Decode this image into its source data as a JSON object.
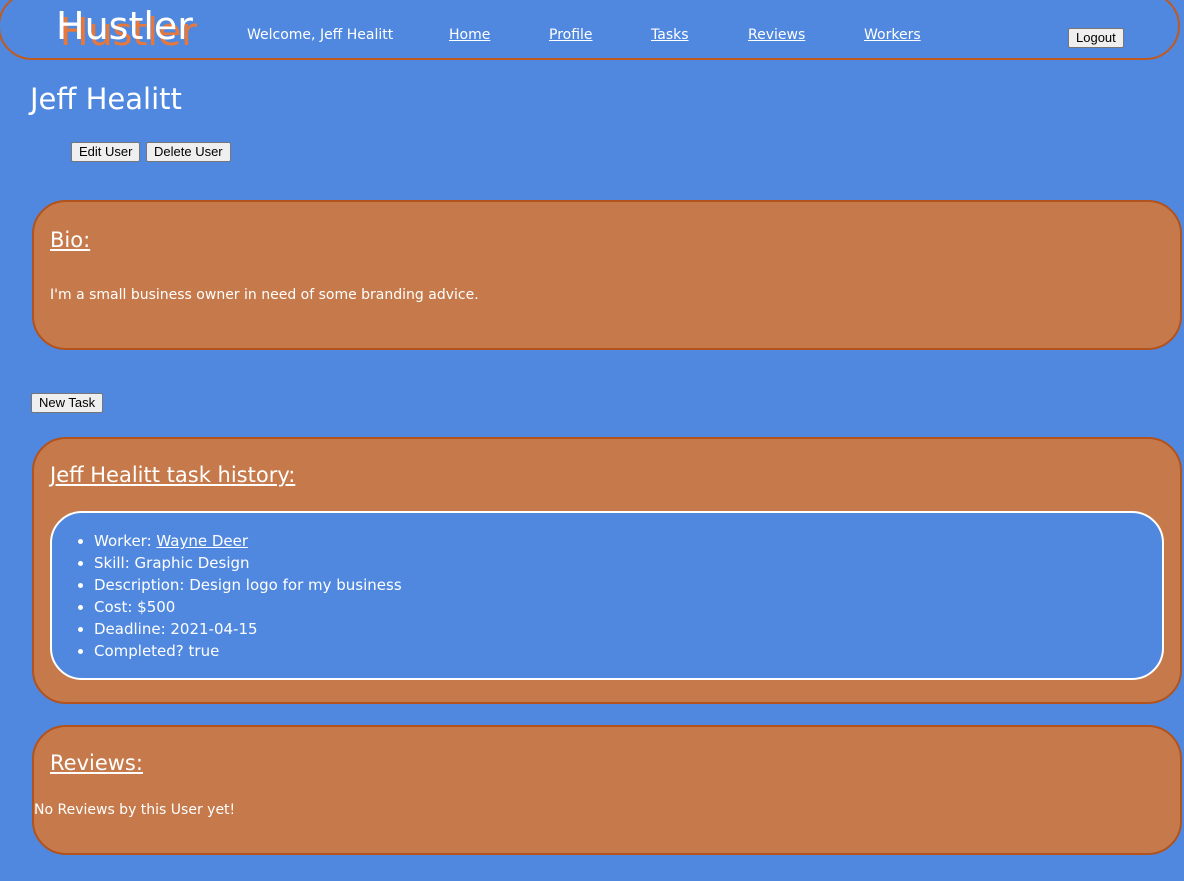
{
  "nav": {
    "logo": "Hustler",
    "welcome": "Welcome, Jeff Healitt",
    "links": [
      "Home",
      "Profile",
      "Tasks",
      "Reviews",
      "Workers"
    ],
    "logout_label": "Logout"
  },
  "user": {
    "name": "Jeff Healitt",
    "edit_label": "Edit User",
    "delete_label": "Delete User"
  },
  "bio": {
    "heading": "Bio:",
    "text": "I'm a small business owner in need of some branding advice."
  },
  "new_task_label": "New Task",
  "task_history": {
    "heading": "Jeff Healitt task history:",
    "tasks": [
      {
        "worker_label": "Worker: ",
        "worker_name": "Wayne Deer",
        "skill": "Skill: Graphic Design",
        "description": "Description: Design logo for my business",
        "cost": "Cost: $500",
        "deadline": "Deadline: 2021-04-15",
        "completed": "Completed? true"
      }
    ]
  },
  "reviews": {
    "heading": "Reviews:",
    "empty_text": "No Reviews by this User yet!"
  },
  "colors": {
    "background": "#5088df",
    "card": "#c67a4b",
    "card_border": "#b2521c",
    "logo_shadow": "#e8783a"
  }
}
